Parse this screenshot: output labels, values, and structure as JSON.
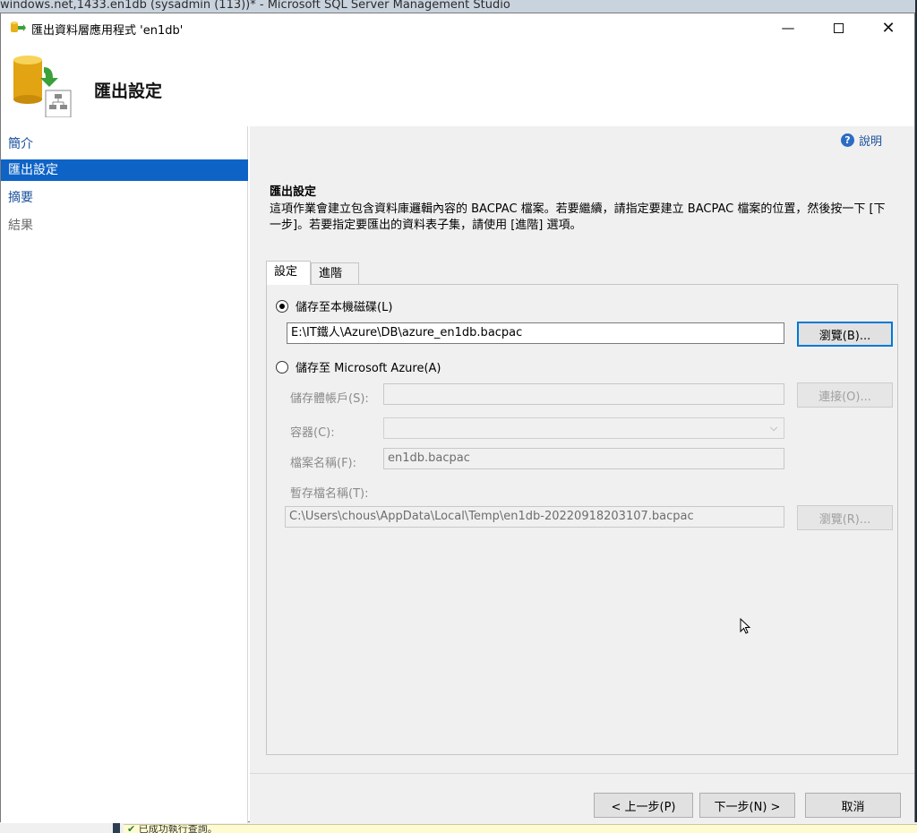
{
  "background": {
    "ssms_title": "windows.net,1433.en1db (sysadmin (113))* - Microsoft SQL Server Management Studio",
    "status_text": "已成功執行查詢。"
  },
  "dialog": {
    "title": "匯出資料層應用程式 'en1db'",
    "heading": "匯出設定"
  },
  "sidebar": {
    "items": [
      {
        "label": "簡介",
        "state": "link"
      },
      {
        "label": "匯出設定",
        "state": "active"
      },
      {
        "label": "摘要",
        "state": "link"
      },
      {
        "label": "結果",
        "state": "disabled"
      }
    ]
  },
  "help": {
    "label": "說明"
  },
  "content": {
    "section_title": "匯出設定",
    "description": "這項作業會建立包含資料庫邏輯內容的 BACPAC 檔案。若要繼續，請指定要建立 BACPAC 檔案的位置，然後按一下 [下一步]。若要指定要匯出的資料表子集，請使用 [進階] 選項。"
  },
  "tabs": {
    "settings": "設定",
    "advanced": "進階"
  },
  "local": {
    "radio_label": "儲存至本機磁碟(L)",
    "selected": true,
    "path_value": "E:\\IT鐵人\\Azure\\DB\\azure_en1db.bacpac",
    "browse_label": "瀏覽(B)..."
  },
  "azure": {
    "radio_label": "儲存至 Microsoft Azure(A)",
    "selected": false,
    "storage_account_label": "儲存體帳戶(S):",
    "connect_label": "連接(O)...",
    "container_label": "容器(C):",
    "filename_label": "檔案名稱(F):",
    "filename_value": "en1db.bacpac",
    "temp_label": "暫存檔名稱(T):",
    "temp_value": "C:\\Users\\chous\\AppData\\Local\\Temp\\en1db-20220918203107.bacpac",
    "temp_browse_label": "瀏覽(R)..."
  },
  "footer": {
    "prev_label": "< 上一步(P)",
    "next_label": "下一步(N) >",
    "cancel_label": "取消"
  },
  "colors": {
    "accent": "#0d63c6",
    "link": "#1a4f9c",
    "panel": "#f0f0f0"
  }
}
